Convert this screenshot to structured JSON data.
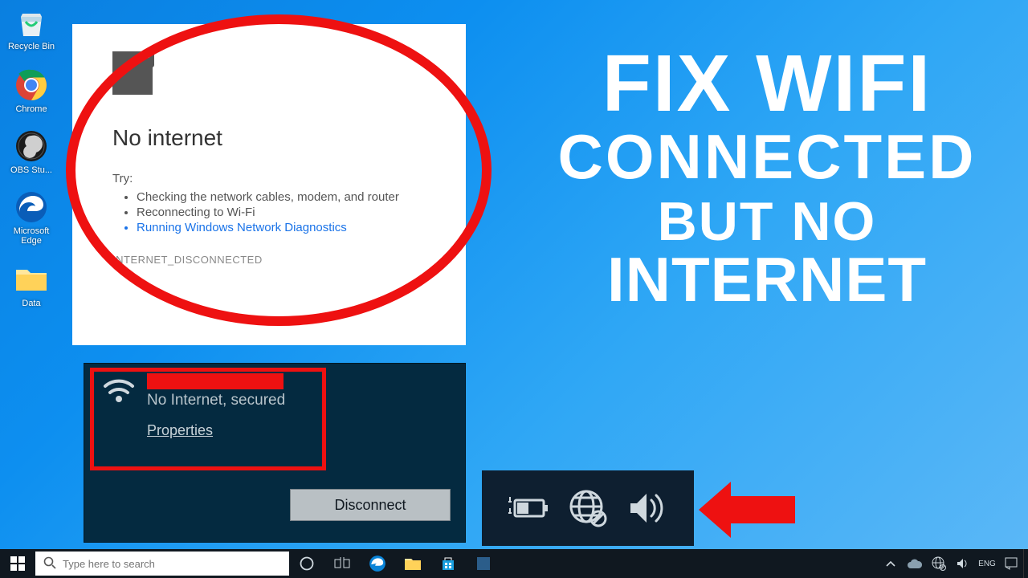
{
  "desktop": {
    "icons": [
      {
        "name": "recycle-bin",
        "label": "Recycle Bin"
      },
      {
        "name": "chrome",
        "label": "Chrome"
      },
      {
        "name": "obs",
        "label": "OBS Stu..."
      },
      {
        "name": "edge",
        "label": "Microsoft Edge"
      },
      {
        "name": "data-folder",
        "label": "Data"
      }
    ]
  },
  "chrome_error": {
    "heading": "No internet",
    "try_label": "Try:",
    "suggestions": [
      "Checking the network cables, modem, and router",
      "Reconnecting to Wi-Fi"
    ],
    "link_suggestion": "Running Windows Network Diagnostics",
    "error_code": "INTERNET_DISCONNECTED"
  },
  "wifi": {
    "status": "No Internet, secured",
    "properties_label": "Properties",
    "disconnect_label": "Disconnect"
  },
  "headline": {
    "line1": "FIX WIFI",
    "line2": "CONNECTED",
    "line3": "BUT NO",
    "line4": "INTERNET"
  },
  "taskbar": {
    "search_placeholder": "Type here to search"
  }
}
